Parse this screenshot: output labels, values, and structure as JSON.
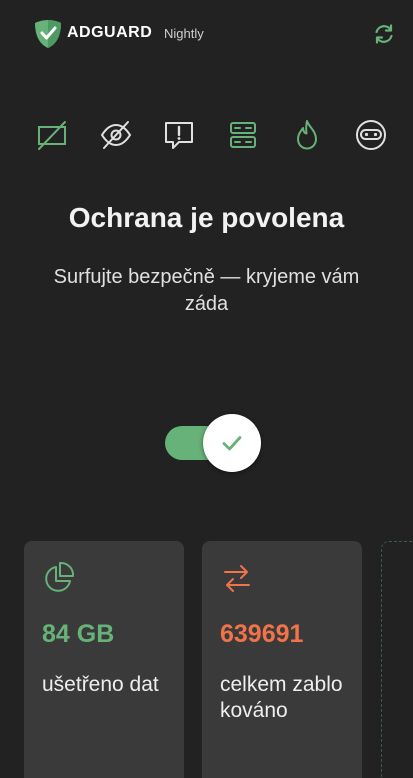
{
  "header": {
    "brand_name": "ADGUARD",
    "brand_tag": "Nightly",
    "logo_icon": "adguard-shield-icon",
    "refresh_icon": "refresh-icon"
  },
  "feature_icons": [
    {
      "icon": "ad-blocking-icon"
    },
    {
      "icon": "tracking-protection-icon"
    },
    {
      "icon": "annoyance-icon"
    },
    {
      "icon": "dns-server-icon"
    },
    {
      "icon": "firewall-icon"
    },
    {
      "icon": "robot-icon"
    }
  ],
  "status": {
    "title": "Ochrana je povolena",
    "subtitle": "Surfujte bezpečně — kryjeme vám záda"
  },
  "toggle": {
    "state": "on"
  },
  "cards": [
    {
      "icon": "pie-chart-icon",
      "value": "84 GB",
      "label": "ušetřeno dat",
      "value_color": "#67b279"
    },
    {
      "icon": "transfer-arrows-icon",
      "value": "639691",
      "label": "celkem zablokováno",
      "value_color": "#f0734a"
    }
  ],
  "colors": {
    "background": "#222222",
    "accent_green": "#67b279",
    "accent_orange": "#f0734a",
    "card_bg": "#3a3a3a"
  }
}
